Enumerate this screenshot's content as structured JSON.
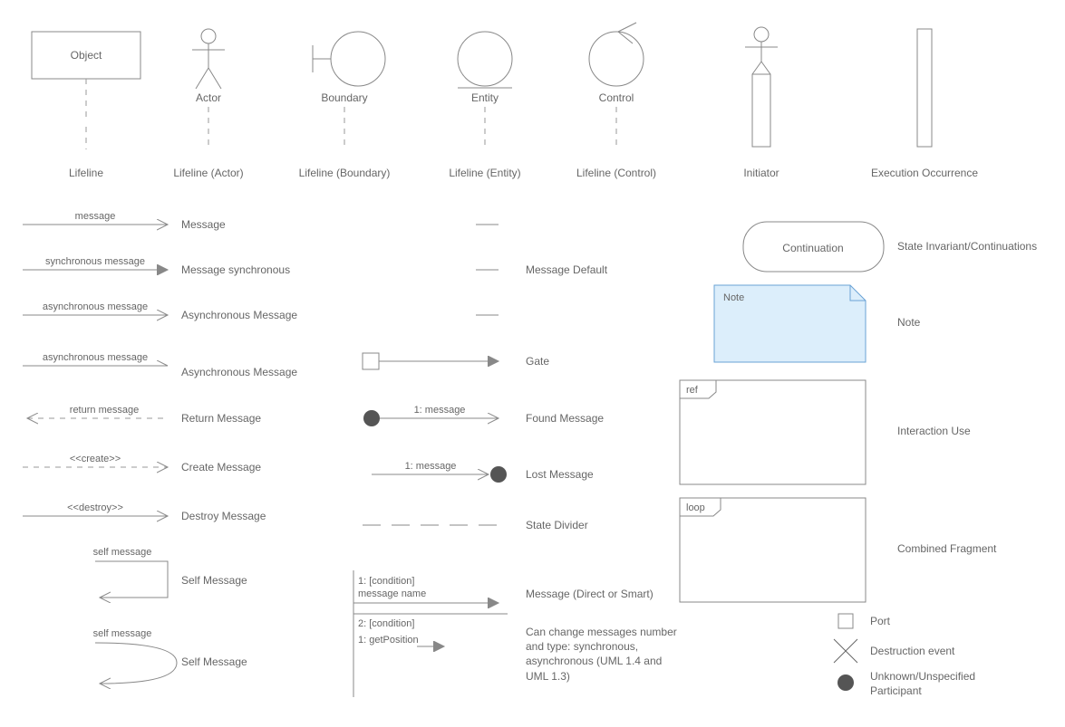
{
  "lifelines": {
    "object": {
      "title": "Object",
      "caption": "Lifeline"
    },
    "actor": {
      "title": "Actor",
      "caption": "Lifeline (Actor)"
    },
    "boundary": {
      "title": "Boundary",
      "caption": "Lifeline (Boundary)"
    },
    "entity": {
      "title": "Entity",
      "caption": "Lifeline (Entity)"
    },
    "control": {
      "title": "Control",
      "caption": "Lifeline (Control)"
    },
    "initiator": {
      "caption": "Initiator"
    },
    "execution": {
      "caption": "Execution Occurrence"
    }
  },
  "messages": {
    "message": {
      "text": "message",
      "caption": "Message"
    },
    "sync": {
      "text": "synchronous message",
      "caption": "Message synchronous"
    },
    "async1": {
      "text": "asynchronous message",
      "caption": "Asynchronous Message"
    },
    "async2": {
      "text": "asynchronous message",
      "caption": "Asynchronous Message"
    },
    "return": {
      "text": "return message",
      "caption": "Return Message"
    },
    "create": {
      "text": "<<create>>",
      "caption": "Create Message"
    },
    "destroy": {
      "text": "<<destroy>>",
      "caption": "Destroy Message"
    },
    "self1": {
      "text": "self message",
      "caption": "Self Message"
    },
    "self2": {
      "text": "self message",
      "caption": "Self Message"
    }
  },
  "mid": {
    "default": {
      "caption": "Message Default"
    },
    "gate": {
      "caption": "Gate"
    },
    "found": {
      "text": "1: message",
      "caption": "Found Message"
    },
    "lost": {
      "text": "1: message",
      "caption": "Lost Message"
    },
    "divider": {
      "caption": "State Divider"
    },
    "multi": {
      "line1": "1: [condition]",
      "line2": "message name",
      "line3": "2: [condition]",
      "line4": "1: getPosition",
      "caption": "Message (Direct or Smart)",
      "desc": "Can change messages number and type: synchronous, asynchronous (UML 1.4 and UML 1.3)"
    }
  },
  "right": {
    "continuation": {
      "text": "Continuation",
      "caption": "State Invariant/Continuations"
    },
    "note": {
      "text": "Note",
      "caption": "Note"
    },
    "interactionUse": {
      "tag": "ref",
      "caption": "Interaction Use"
    },
    "combined": {
      "tag": "loop",
      "caption": "Combined Fragment"
    },
    "port": {
      "caption": "Port"
    },
    "destruction": {
      "caption": "Destruction event"
    },
    "unknown": {
      "caption": "Unknown/Unspecified Participant"
    }
  }
}
